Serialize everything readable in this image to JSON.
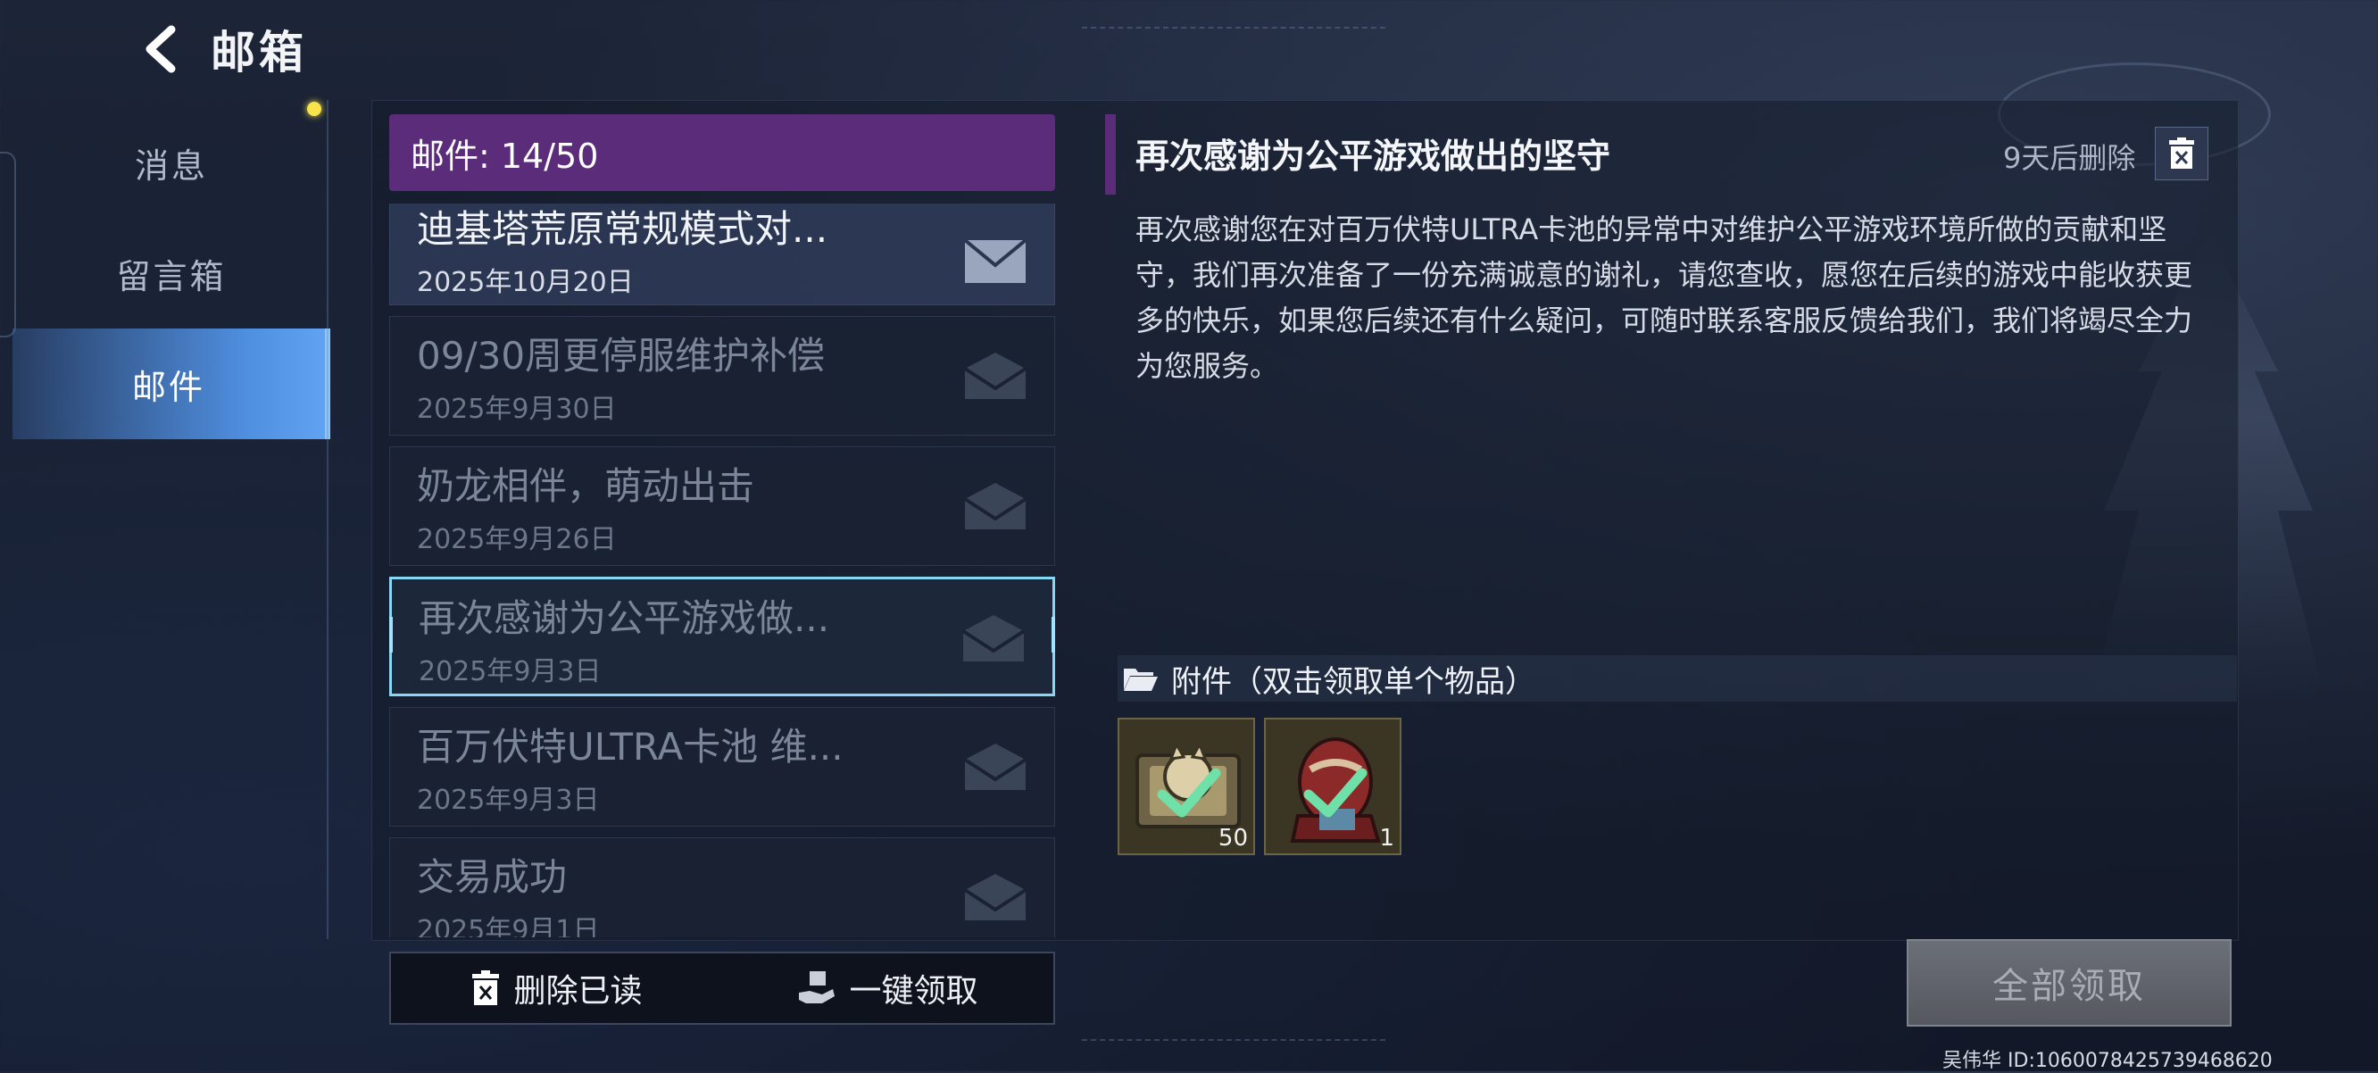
{
  "header": {
    "title": "邮箱"
  },
  "nav": {
    "items": [
      {
        "label": "消息"
      },
      {
        "label": "留言箱"
      },
      {
        "label": "邮件"
      }
    ]
  },
  "mailbox": {
    "count_label": "邮件: 14/50"
  },
  "mails": [
    {
      "title": "迪基塔荒原常规模式对...",
      "date": "2025年10月20日"
    },
    {
      "title": "09/30周更停服维护补偿",
      "date": "2025年9月30日"
    },
    {
      "title": "奶龙相伴，萌动出击",
      "date": "2025年9月26日"
    },
    {
      "title": "再次感谢为公平游戏做...",
      "date": "2025年9月3日"
    },
    {
      "title": "百万伏特ULTRA卡池 维...",
      "date": "2025年9月3日"
    },
    {
      "title": "交易成功",
      "date": "2025年9月1日"
    }
  ],
  "actions": {
    "delete_read": "删除已读",
    "claim_one_key": "一键领取"
  },
  "detail": {
    "title": "再次感谢为公平游戏做出的坚守",
    "expire": "9天后删除",
    "body": "再次感谢您在对百万伏特ULTRA卡池的异常中对维护公平游戏环境所做的贡献和坚守，我们再次准备了一份充满诚意的谢礼，请您查收，愿您在后续的游戏中能收获更多的快乐，如果您后续还有什么疑问，可随时联系客服反馈给我们，我们将竭尽全力为您服务。",
    "attach_label": "附件（双击领取单个物品）",
    "attachments": [
      {
        "qty": "50",
        "icon": "ticket-icon",
        "claimed": true
      },
      {
        "qty": "1",
        "icon": "egg-icon",
        "claimed": true
      }
    ],
    "claim_all": "全部领取"
  },
  "footer": {
    "user": "吴伟华",
    "id": "ID:1060078425739468620"
  },
  "colors": {
    "accent_purple": "#5a2c7a",
    "nav_active": "#4f8fe0",
    "selected_border": "#88d8f5",
    "check_green": "#6fe0a8"
  }
}
